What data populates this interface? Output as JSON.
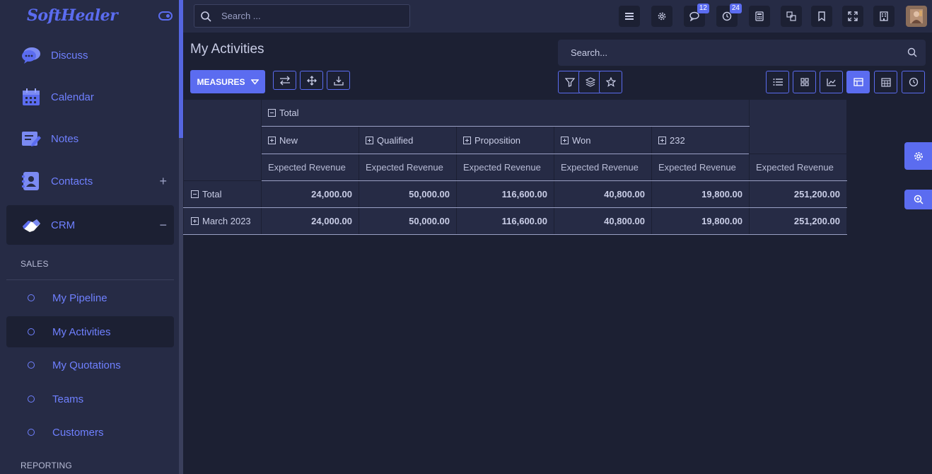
{
  "brand": {
    "logo_text": "SoftHealer"
  },
  "sidebar": {
    "apps": [
      {
        "label": "Discuss",
        "icon": "chat-bubbles-icon"
      },
      {
        "label": "Calendar",
        "icon": "calendar-icon"
      },
      {
        "label": "Notes",
        "icon": "notes-icon"
      },
      {
        "label": "Contacts",
        "icon": "contacts-icon",
        "action": "+"
      },
      {
        "label": "CRM",
        "icon": "handshake-icon",
        "action": "−"
      }
    ],
    "section_sales": "SALES",
    "sales_items": [
      "My Pipeline",
      "My Activities",
      "My Quotations",
      "Teams",
      "Customers"
    ],
    "section_reporting": "REPORTING"
  },
  "topbar": {
    "search_placeholder": "Search ...",
    "chat_badge": "12",
    "activity_badge": "24"
  },
  "page": {
    "title": "My Activities",
    "search_placeholder": "Search...",
    "measures_label": "MEASURES"
  },
  "pivot": {
    "col_total_label": "Total",
    "col_groups": [
      "New",
      "Qualified",
      "Proposition",
      "Won",
      "232"
    ],
    "measure_label": "Expected Revenue",
    "rows": [
      {
        "label": "Total",
        "values": [
          "24,000.00",
          "50,000.00",
          "116,600.00",
          "40,800.00",
          "19,800.00",
          "251,200.00"
        ]
      },
      {
        "label": "March 2023",
        "values": [
          "24,000.00",
          "50,000.00",
          "116,600.00",
          "40,800.00",
          "19,800.00",
          "251,200.00"
        ]
      }
    ]
  },
  "colors": {
    "accent": "#5b6cf0",
    "bg": "#1c2033",
    "panel": "#262b45"
  }
}
